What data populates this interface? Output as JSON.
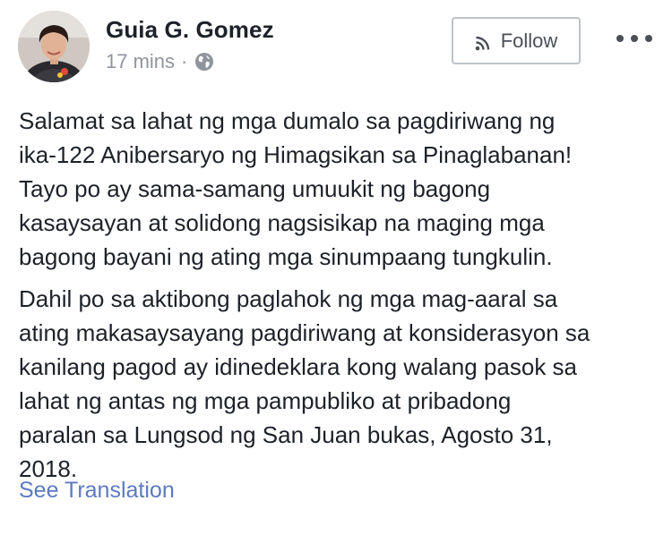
{
  "post": {
    "author": {
      "name": "Guia G. Gomez",
      "avatar_icon": "profile-photo"
    },
    "meta": {
      "timestamp": "17 mins",
      "separator": "·",
      "privacy_icon": "globe-icon"
    },
    "follow_button": {
      "label": "Follow",
      "icon": "rss-icon"
    },
    "more_icon": "more-options-icon",
    "paragraphs": [
      "Salamat sa lahat ng mga dumalo sa pagdiriwang ng\nika-122 Anibersaryo ng Himagsikan sa Pinaglabanan!\nTayo po ay sama-samang umuukit ng bagong\nkasaysayan at solidong nagsisikap na maging mga\nbagong bayani ng ating mga sinumpaang tungkulin.",
      "Dahil po sa aktibong paglahok ng mga mag-aaral sa\nating makasaysayang pagdiriwang at konsiderasyon sa\nkanilang pagod ay idinedeklara kong walang pasok sa\nlahat ng antas ng mga pampubliko at pribadong\nparalan sa Lungsod ng San Juan bukas, Agosto 31,\n2018."
    ],
    "see_translation": "See Translation"
  },
  "colors": {
    "text": "#1d2129",
    "secondary": "#90949c",
    "link": "#5b7bc0",
    "button_border": "#bec3c9"
  }
}
